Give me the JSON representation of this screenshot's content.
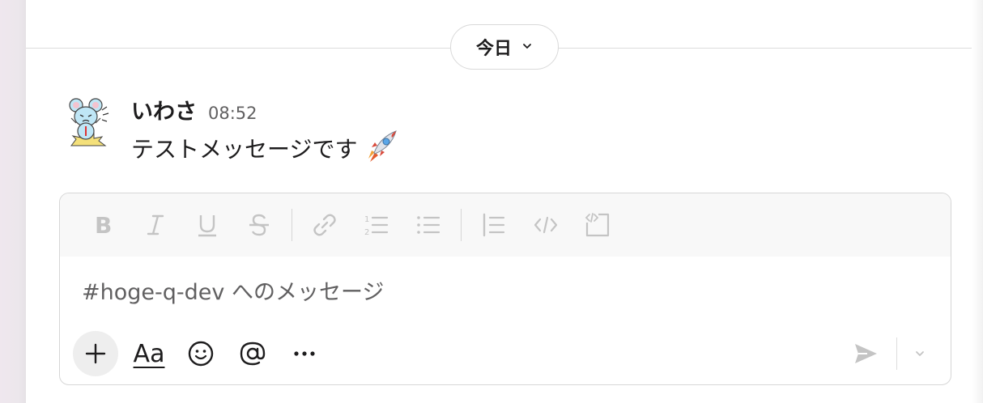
{
  "date_divider": {
    "label": "今日",
    "icon": "chevron-down-icon"
  },
  "message": {
    "author": "いわさ",
    "time": "08:52",
    "text": "テストメッセージです",
    "emoji": "rocket-icon"
  },
  "composer": {
    "placeholder": "#hoge-q-dev へのメッセージ",
    "format_tools": [
      "bold-icon",
      "italic-icon",
      "underline-icon",
      "strikethrough-icon",
      "link-icon",
      "ordered-list-icon",
      "bulleted-list-icon",
      "blockquote-icon",
      "code-icon",
      "code-block-icon"
    ],
    "format_label": "Aa",
    "bottom_tools": [
      "plus-icon",
      "format-text-icon",
      "emoji-icon",
      "mention-icon",
      "more-icon"
    ],
    "send_icon": "send-icon"
  },
  "colors": {
    "text": "#1d1c1d",
    "muted": "#616061",
    "disabled_icon": "#c4c4c4",
    "composer_border": "#d6d6d6",
    "toolbar_bg": "#f8f8f8"
  }
}
